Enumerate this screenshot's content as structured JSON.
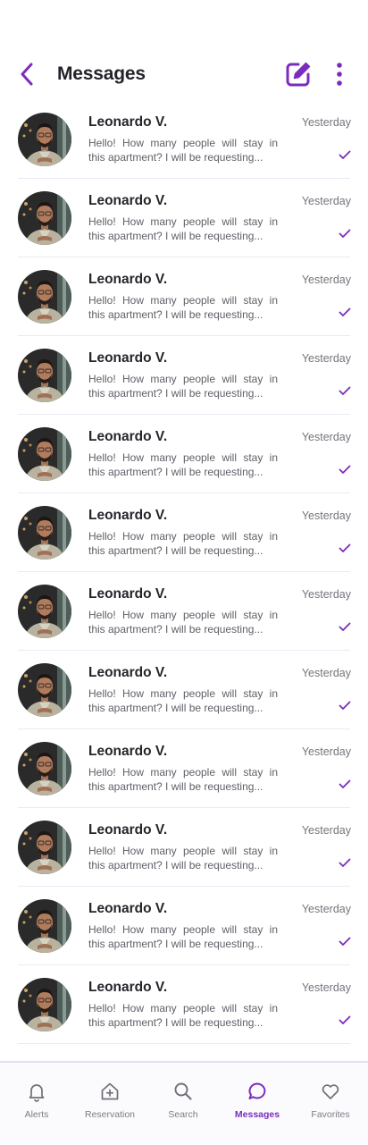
{
  "header": {
    "title": "Messages"
  },
  "conversations": [
    {
      "name": "Leonardo V.",
      "time": "Yesterday",
      "preview_line1": "Hello! How many people will stay in",
      "preview_line2": "this apartment? I will be requesting..."
    },
    {
      "name": "Leonardo V.",
      "time": "Yesterday",
      "preview_line1": "Hello! How many people will stay in",
      "preview_line2": "this apartment? I will be requesting..."
    },
    {
      "name": "Leonardo V.",
      "time": "Yesterday",
      "preview_line1": "Hello! How many people will stay in",
      "preview_line2": "this apartment? I will be requesting..."
    },
    {
      "name": "Leonardo V.",
      "time": "Yesterday",
      "preview_line1": "Hello! How many people will stay in",
      "preview_line2": "this apartment? I will be requesting..."
    },
    {
      "name": "Leonardo V.",
      "time": "Yesterday",
      "preview_line1": "Hello! How many people will stay in",
      "preview_line2": "this apartment? I will be requesting..."
    },
    {
      "name": "Leonardo V.",
      "time": "Yesterday",
      "preview_line1": "Hello! How many people will stay in",
      "preview_line2": "this apartment? I will be requesting..."
    },
    {
      "name": "Leonardo V.",
      "time": "Yesterday",
      "preview_line1": "Hello! How many people will stay in",
      "preview_line2": "this apartment? I will be requesting..."
    },
    {
      "name": "Leonardo V.",
      "time": "Yesterday",
      "preview_line1": "Hello! How many people will stay in",
      "preview_line2": "this apartment? I will be requesting..."
    },
    {
      "name": "Leonardo V.",
      "time": "Yesterday",
      "preview_line1": "Hello! How many people will stay in",
      "preview_line2": "this apartment? I will be requesting..."
    },
    {
      "name": "Leonardo V.",
      "time": "Yesterday",
      "preview_line1": "Hello! How many people will stay in",
      "preview_line2": "this apartment? I will be requesting..."
    },
    {
      "name": "Leonardo V.",
      "time": "Yesterday",
      "preview_line1": "Hello! How many people will stay in",
      "preview_line2": "this apartment? I will be requesting..."
    },
    {
      "name": "Leonardo V.",
      "time": "Yesterday",
      "preview_line1": "Hello! How many people will stay in",
      "preview_line2": "this apartment? I will be requesting..."
    }
  ],
  "bottom_nav": {
    "items": [
      {
        "label": "Alerts",
        "icon": "bell-icon",
        "active": false
      },
      {
        "label": "Reservation",
        "icon": "house-plus-icon",
        "active": false
      },
      {
        "label": "Search",
        "icon": "search-icon",
        "active": false
      },
      {
        "label": "Messages",
        "icon": "chat-bubble-icon",
        "active": true
      },
      {
        "label": "Favorites",
        "icon": "heart-icon",
        "active": false
      }
    ]
  },
  "colors": {
    "accent": "#7b2cbf",
    "text_primary": "#25252b",
    "text_secondary": "#5f5f68",
    "divider": "#ece9f5"
  }
}
